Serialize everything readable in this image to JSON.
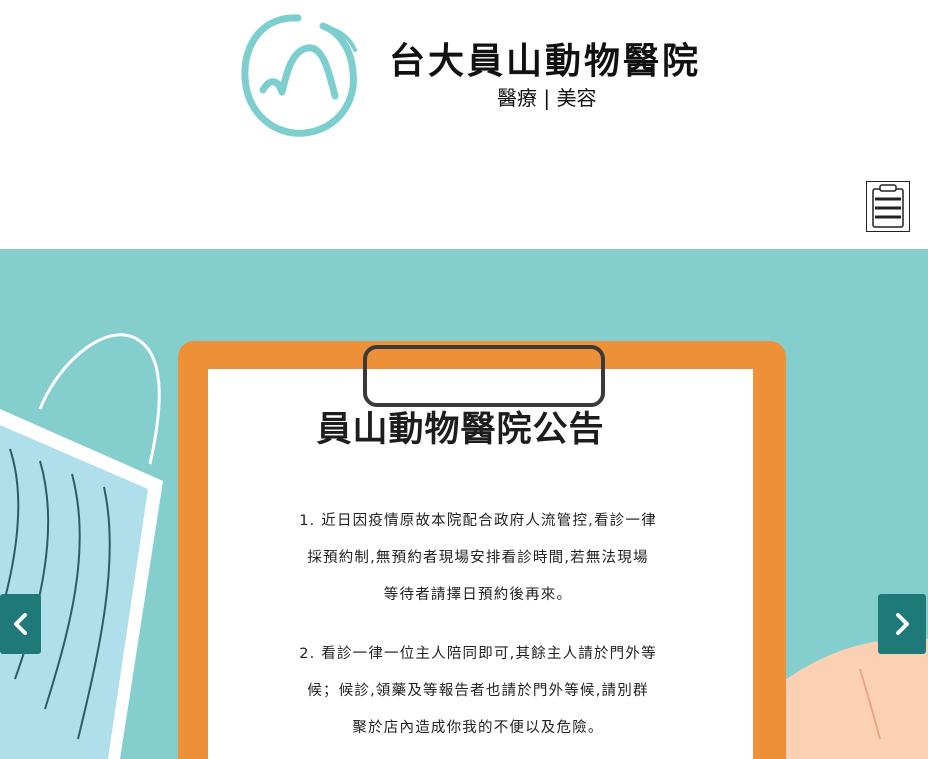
{
  "header": {
    "brand_name": "台大員山動物醫院",
    "brand_sub": "醫療 | 美容"
  },
  "nav": {
    "menu_icon": "clipboard-menu-icon"
  },
  "slide": {
    "title": "員山動物醫院公告",
    "items": [
      {
        "lines": [
          "1.  近日因疫情原故本院配合政府人流管控,看診一律",
          "採預約制,無預約者現場安排看診時間,若無法現場",
          "等待者請擇日預約後再來。"
        ]
      },
      {
        "lines": [
          "2.  看診一律一位主人陪同即可,其餘主人請於門外等",
          "候；候診,領藥及等報告者也請於門外等候,請別群",
          "聚於店內造成你我的不便以及危險。"
        ]
      }
    ]
  },
  "carousel": {
    "prev_icon": "chevron-left-icon",
    "next_icon": "chevron-right-icon"
  },
  "colors": {
    "teal_bg": "#84cfcd",
    "logo_teal": "#7dcfcf",
    "clipboard_orange": "#ee9037",
    "arrow_bg": "#1e7a78"
  }
}
